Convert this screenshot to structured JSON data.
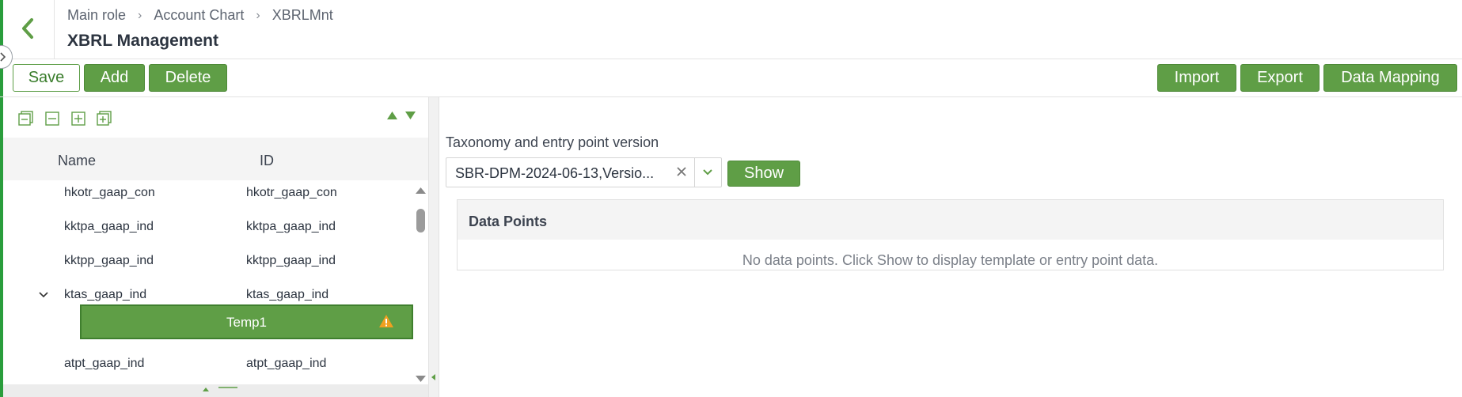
{
  "header": {
    "breadcrumb": [
      "Main role",
      "Account Chart",
      "XBRLMnt"
    ],
    "title": "XBRL Management"
  },
  "toolbar": {
    "save_label": "Save",
    "add_label": "Add",
    "delete_label": "Delete",
    "import_label": "Import",
    "export_label": "Export",
    "data_mapping_label": "Data Mapping"
  },
  "tree": {
    "columns": {
      "name": "Name",
      "id": "ID"
    },
    "rows": [
      {
        "name": "hkotr_gaap_con",
        "id": "hkotr_gaap_con"
      },
      {
        "name": "kktpa_gaap_ind",
        "id": "kktpa_gaap_ind"
      },
      {
        "name": "kktpp_gaap_ind",
        "id": "kktpp_gaap_ind"
      },
      {
        "name": "ktas_gaap_ind",
        "id": "ktas_gaap_ind",
        "expanded": true
      },
      {
        "name": "atpt_gaap_ind",
        "id": "atpt_gaap_ind"
      }
    ],
    "selected_child": {
      "label": "Temp1",
      "status_icon": "warning-icon"
    }
  },
  "taxonomy": {
    "label": "Taxonomy and entry point version",
    "selected_value": "SBR-DPM-2024-06-13,Versio...",
    "show_label": "Show"
  },
  "data_points": {
    "title": "Data Points",
    "empty_message": "No data points. Click Show to display template or entry point data."
  },
  "colors": {
    "accent_green": "#5f9e46",
    "left_accent": "#2a9d3c",
    "warning": "#f0a020"
  }
}
